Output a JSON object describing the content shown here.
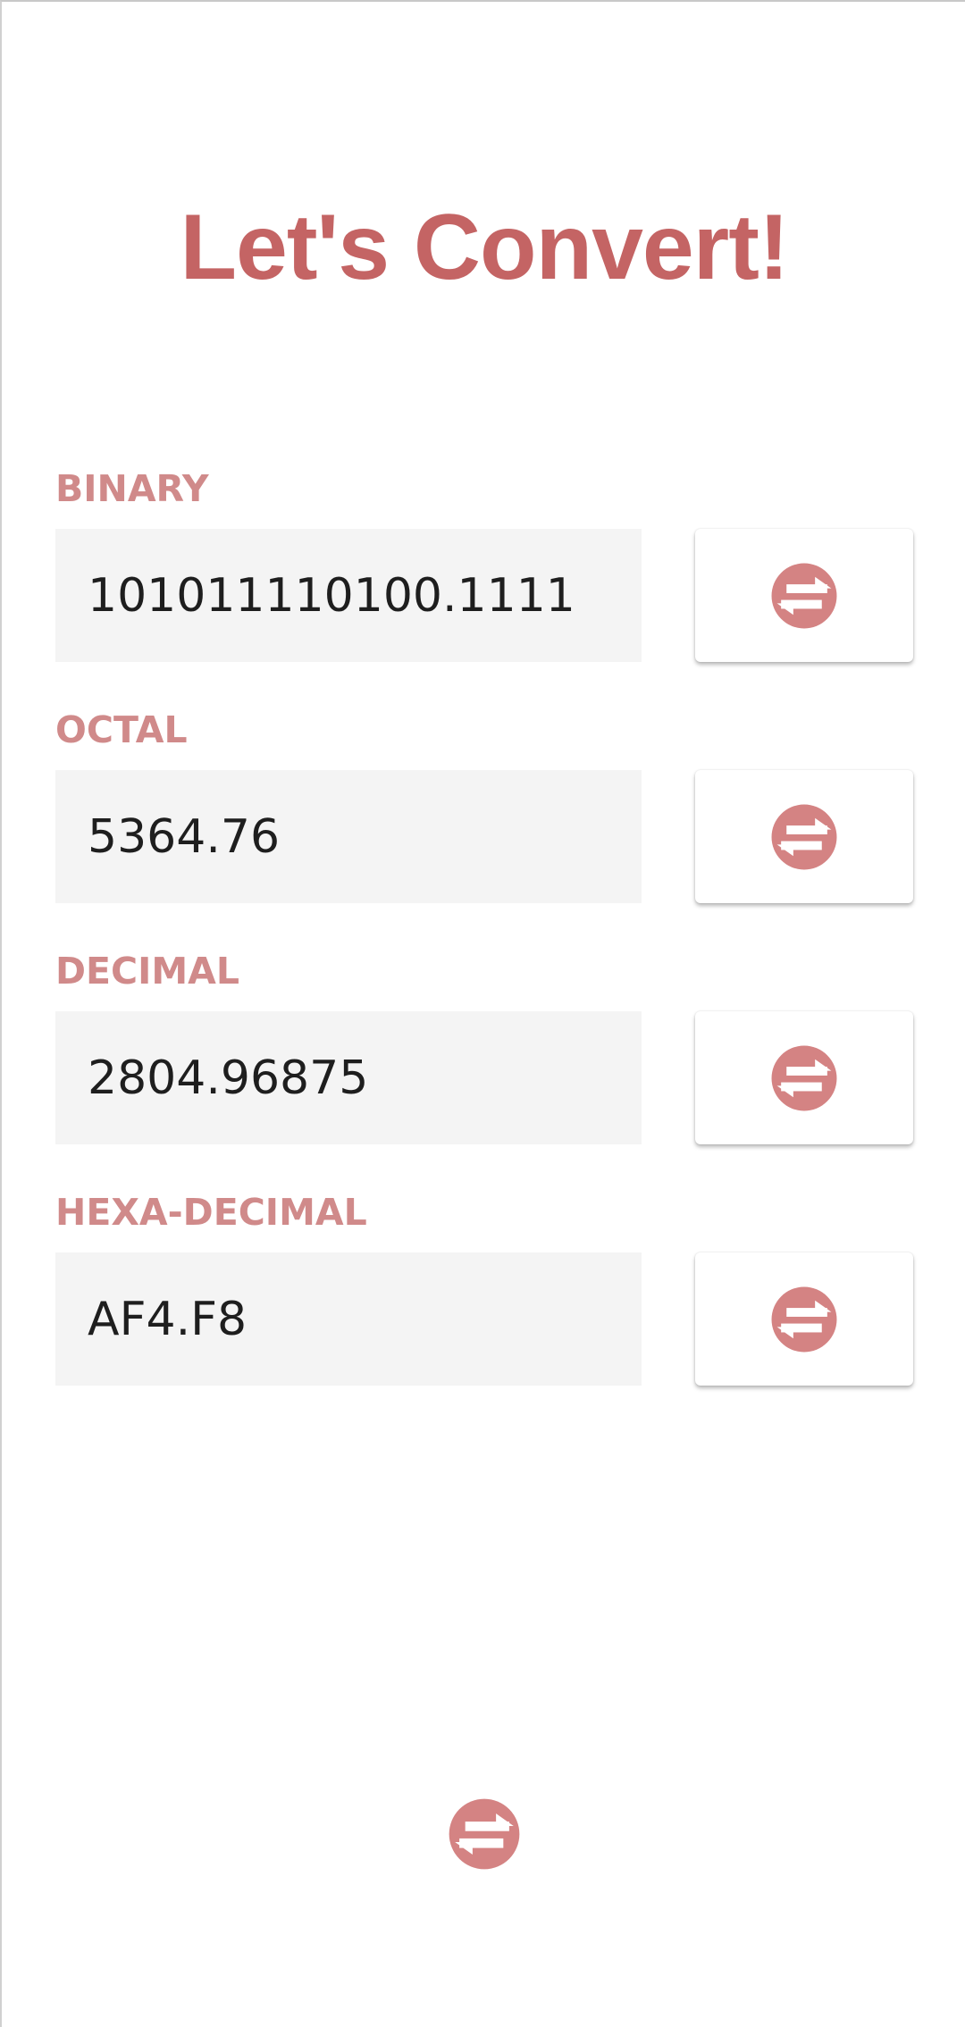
{
  "app": {
    "title": "Let's Convert!"
  },
  "fields": {
    "binary": {
      "label": "BINARY",
      "value": "101011110100.1111",
      "icon": "swap-arrows-icon"
    },
    "octal": {
      "label": "OCTAL",
      "value": "5364.76",
      "icon": "swap-arrows-icon"
    },
    "decimal": {
      "label": "DECIMAL",
      "value": "2804.96875",
      "icon": "swap-arrows-icon"
    },
    "hexadecimal": {
      "label": "HEXA-DECIMAL",
      "value": "AF4.F8",
      "icon": "swap-arrows-icon"
    }
  },
  "bottom_button": {
    "icon": "swap-arrows-icon"
  },
  "colors": {
    "title": "#c46464",
    "label": "#d08a8a",
    "icon": "#d48383",
    "field_background": "#f4f4f4",
    "value_text": "#1e1e1e"
  }
}
